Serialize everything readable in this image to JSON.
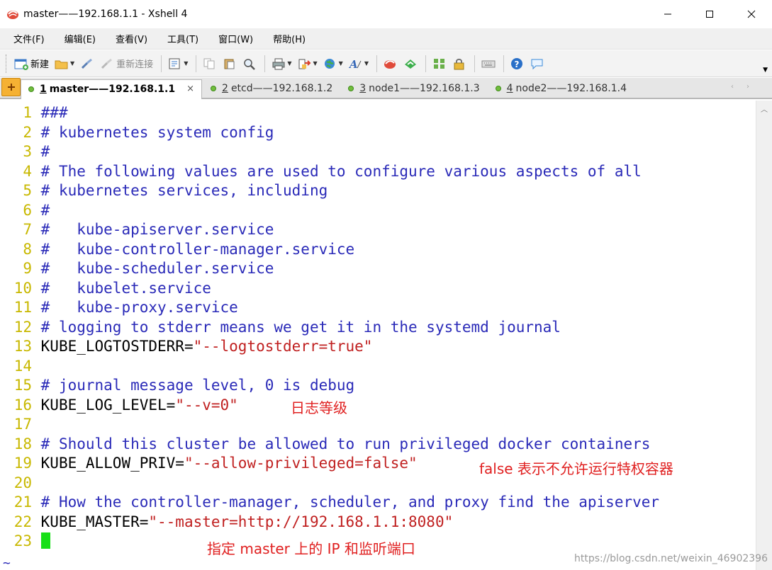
{
  "window": {
    "title": "master——192.168.1.1 - Xshell 4",
    "minimize_glyph": "─",
    "maximize_glyph": "☐",
    "close_glyph": "✕"
  },
  "menu": [
    "文件(F)",
    "编辑(E)",
    "查看(V)",
    "工具(T)",
    "窗口(W)",
    "帮助(H)"
  ],
  "toolbar": {
    "new_label": "新建",
    "reconnect_label": "重新连接",
    "icons": [
      "new-session-icon",
      "open-folder-icon",
      "connect-icon",
      "reconnect-icon",
      "properties-icon",
      "copy-icon",
      "paste-icon",
      "find-icon",
      "print-icon",
      "transfer-icon",
      "globe-icon",
      "font-icon",
      "xftp-icon",
      "xagent-icon",
      "fullscreen-icon",
      "lock-icon",
      "keyboard-icon",
      "help-icon",
      "chat-icon"
    ]
  },
  "tabs": [
    {
      "num": "1",
      "label": "master——192.168.1.1",
      "active": true
    },
    {
      "num": "2",
      "label": "etcd——192.168.1.2",
      "active": false
    },
    {
      "num": "3",
      "label": "node1——192.168.1.3",
      "active": false
    },
    {
      "num": "4",
      "label": "node2——192.168.1.4",
      "active": false
    }
  ],
  "tab_close_glyph": "×",
  "terminal": {
    "lines": [
      {
        "n": "1",
        "comment": "###"
      },
      {
        "n": "2",
        "comment": "# kubernetes system config"
      },
      {
        "n": "3",
        "comment": "#"
      },
      {
        "n": "4",
        "comment": "# The following values are used to configure various aspects of all"
      },
      {
        "n": "5",
        "comment": "# kubernetes services, including"
      },
      {
        "n": "6",
        "comment": "#"
      },
      {
        "n": "7",
        "comment": "#   kube-apiserver.service"
      },
      {
        "n": "8",
        "comment": "#   kube-controller-manager.service"
      },
      {
        "n": "9",
        "comment": "#   kube-scheduler.service"
      },
      {
        "n": "10",
        "comment": "#   kubelet.service"
      },
      {
        "n": "11",
        "comment": "#   kube-proxy.service"
      },
      {
        "n": "12",
        "comment": "# logging to stderr means we get it in the systemd journal"
      },
      {
        "n": "13",
        "key": "KUBE_LOGTOSTDERR=",
        "value": "\"--logtostderr=true\""
      },
      {
        "n": "14"
      },
      {
        "n": "15",
        "comment": "# journal message level, 0 is debug"
      },
      {
        "n": "16",
        "key": "KUBE_LOG_LEVEL=",
        "value": "\"--v=0\""
      },
      {
        "n": "17"
      },
      {
        "n": "18",
        "comment": "# Should this cluster be allowed to run privileged docker containers"
      },
      {
        "n": "19",
        "key": "KUBE_ALLOW_PRIV=",
        "value": "\"--allow-privileged=false\""
      },
      {
        "n": "20"
      },
      {
        "n": "21",
        "comment": "# How the controller-manager, scheduler, and proxy find the apiserver"
      },
      {
        "n": "22",
        "key": "KUBE_MASTER=",
        "value": "\"--master=http://192.168.1.1:8080\""
      },
      {
        "n": "23",
        "cursor": true
      }
    ],
    "tilde": "~"
  },
  "annotations": {
    "log_level": "日志等级",
    "allow_priv": "false 表示不允许运行特权容器",
    "master": "指定 master 上的 IP 和监听端口"
  },
  "watermark": "https://blog.csdn.net/weixin_46902396",
  "colors": {
    "line_number": "#c8b800",
    "comment": "#2a2ab8",
    "string": "#c02020",
    "cursor": "#18e018",
    "annotation": "#e02020"
  }
}
